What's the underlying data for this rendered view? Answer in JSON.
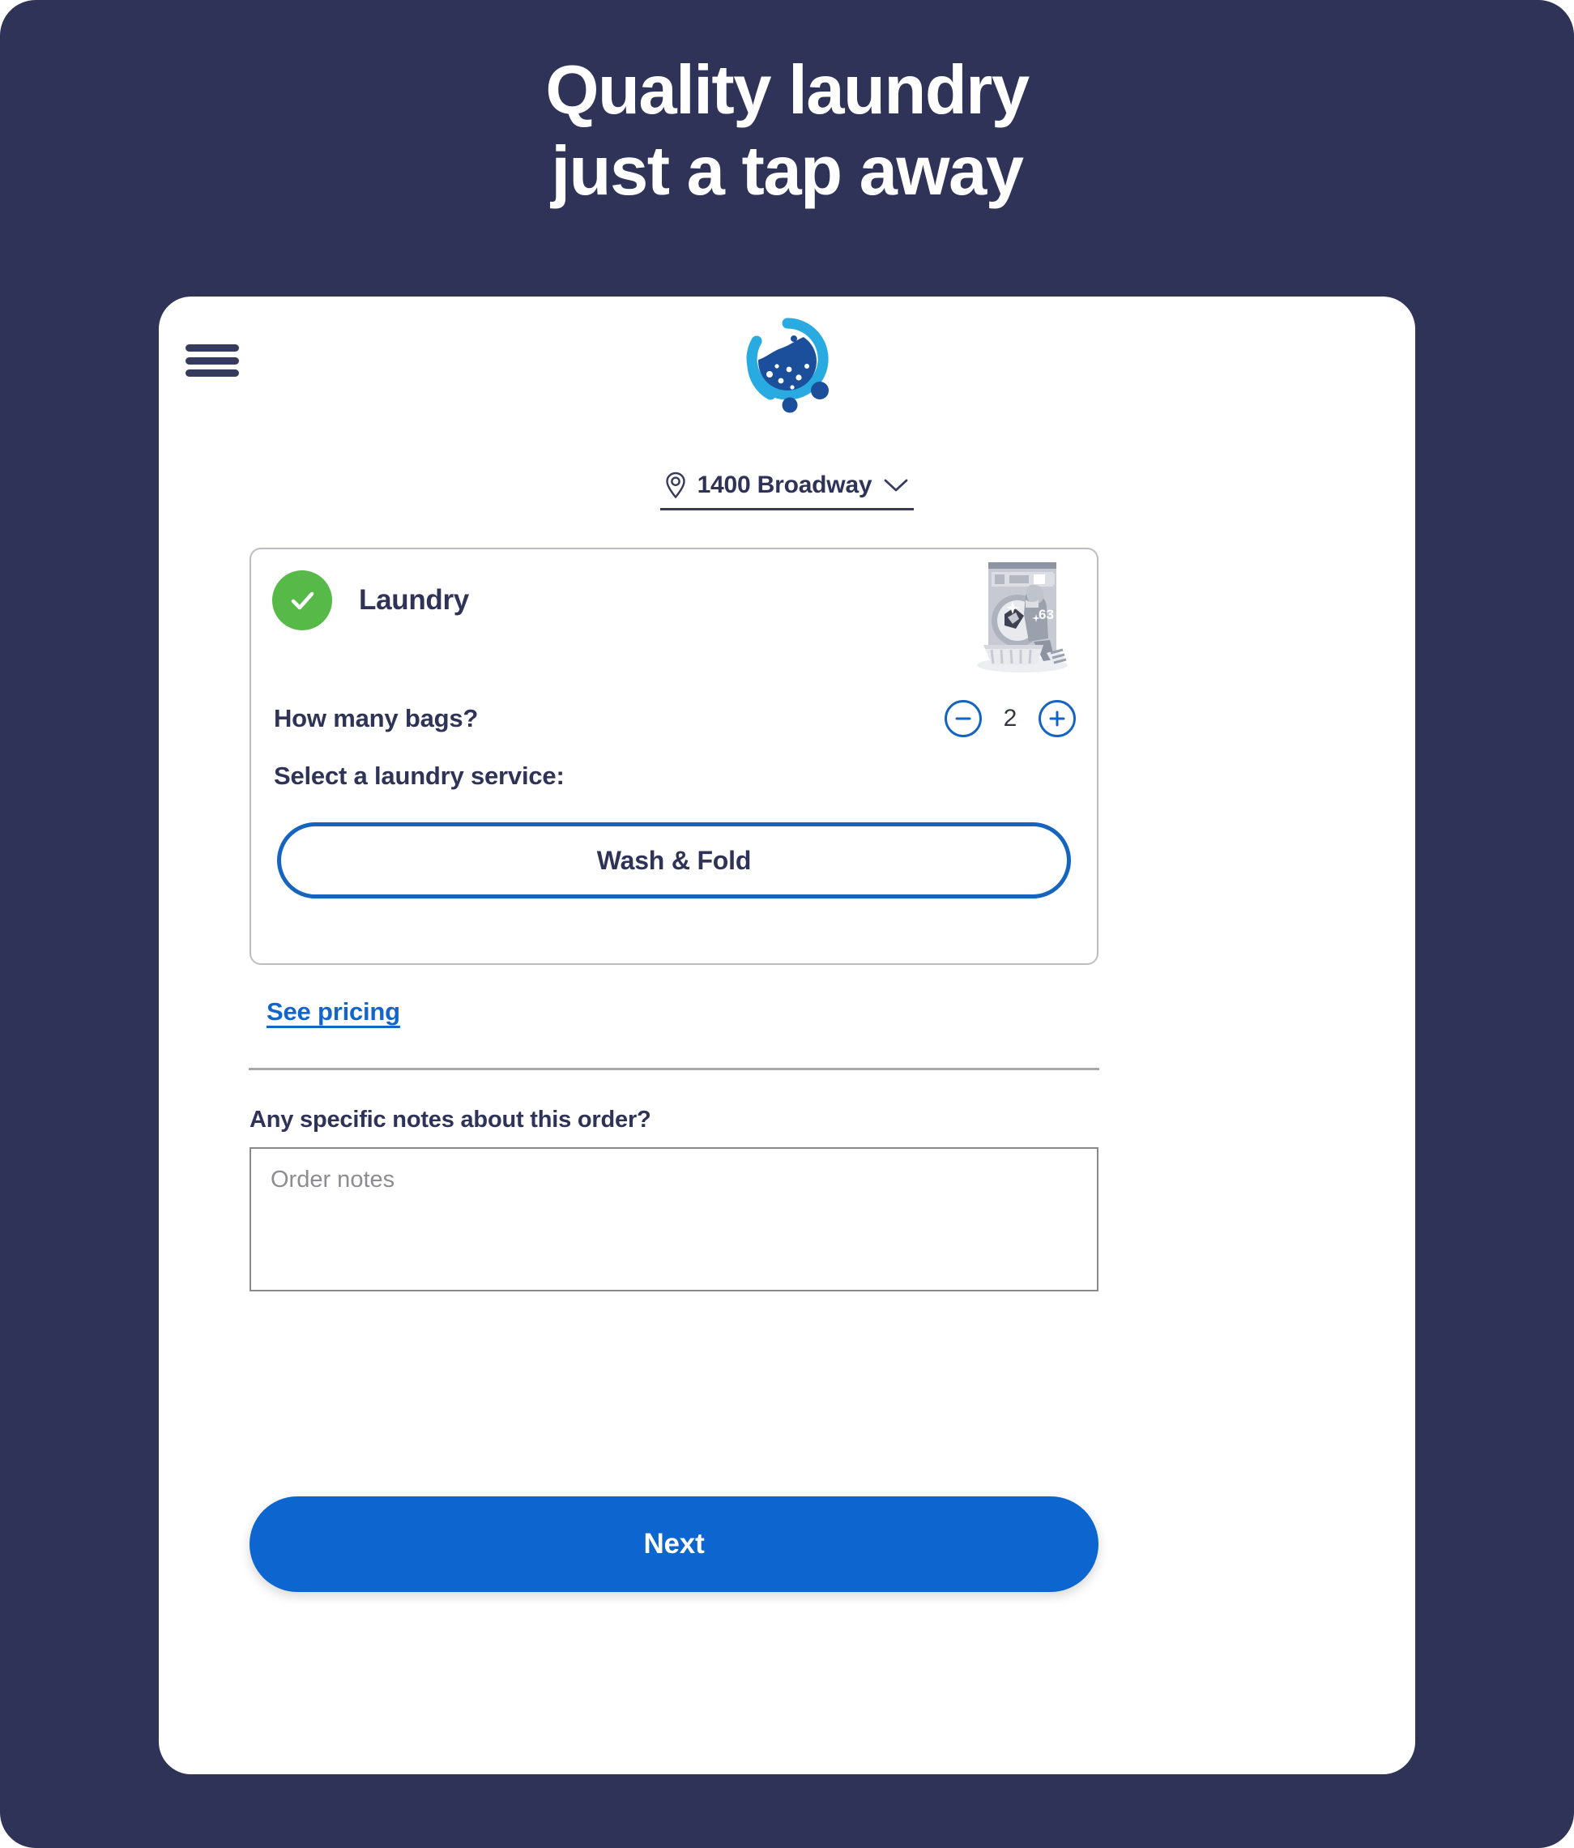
{
  "promo": {
    "headline_line1": "Quality laundry",
    "headline_line2": "just a tap away",
    "background_color": "#2e3357"
  },
  "app": {
    "menu_icon": "hamburger-menu-icon",
    "logo_alt": "laundry-bubble-logo",
    "logo_colors": {
      "ring": "#29abe2",
      "liquid": "#1b4f9c"
    },
    "location": {
      "pin_icon": "map-pin-icon",
      "address": "1400 Broadway",
      "chevron_icon": "chevron-down-icon"
    },
    "service_card": {
      "selected_icon": "check-circle-icon",
      "selected_color": "#57b947",
      "title": "Laundry",
      "illustration_alt": "person-loading-washing-machine-illustration",
      "bags_label": "How many bags?",
      "decrement_icon": "minus-circle-icon",
      "increment_icon": "plus-circle-icon",
      "bags_count": "2",
      "select_service_label": "Select a laundry service:",
      "service_option": "Wash & Fold",
      "accent_color": "#1565c0"
    },
    "see_pricing_label": "See pricing",
    "notes": {
      "label": "Any specific notes about this order?",
      "placeholder": "Order notes",
      "value": ""
    },
    "next_button_label": "Next",
    "next_button_color": "#0d66cf"
  }
}
